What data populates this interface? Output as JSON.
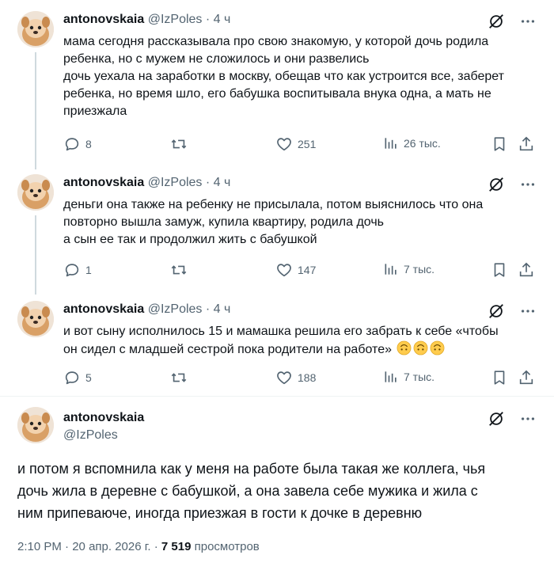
{
  "colors": {
    "text": "#0f1419",
    "muted": "#536471",
    "line": "#cfd9de"
  },
  "replies": [
    {
      "name": "antonovskaia",
      "handle": "@IzPoles",
      "time": "4 ч",
      "lines": [
        "мама сегодня рассказывала про свою знакомую, у которой дочь родила",
        "ребенка, но с мужем не сложилось и они развелись",
        "дочь уехала на заработки в москву, обещав что как устроится все, заберет",
        "ребенка, но время шло, его бабушка воспитывала внука одна, а мать не",
        "приезжала"
      ],
      "replies_count": "8",
      "retweets": "",
      "likes": "251",
      "views": "26 тыс."
    },
    {
      "name": "antonovskaia",
      "handle": "@IzPoles",
      "time": "4 ч",
      "lines": [
        "деньги она также на ребенку не присылала, потом выяснилось что она",
        "повторно вышла замуж, купила квартиру, родила дочь",
        "а сын ее так и продолжил жить с бабушкой"
      ],
      "replies_count": "1",
      "retweets": "",
      "likes": "147",
      "views": "7 тыс."
    },
    {
      "name": "antonovskaia",
      "handle": "@IzPoles",
      "time": "4 ч",
      "lines": [
        "и вот сыну исполнилось 15 и мамашка решила его забрать к себе «чтобы",
        "он сидел с младшей сестрой пока родители на работе»"
      ],
      "emoji": "upside-down-face-icon",
      "replies_count": "5",
      "retweets": "",
      "likes": "188",
      "views": "7 тыс."
    }
  ],
  "main": {
    "name": "antonovskaia",
    "handle": "@IzPoles",
    "lines": [
      "и потом я вспомнила как у меня на работе была такая же коллега, чья",
      "дочь жила в деревне с бабушкой, а она завела себе мужика и жила с",
      "ним припеваюче, иногда приезжая в гости к дочке в деревню"
    ],
    "time": "2:10 PM",
    "date": "20 апр. 2026 г.",
    "views_count": "7 519",
    "views_label": "просмотров"
  },
  "icons": {
    "grok": "grok-icon",
    "more": "more-icon",
    "reply": "reply-icon",
    "retweet": "retweet-icon",
    "like": "like-icon",
    "views": "views-icon",
    "bookmark": "bookmark-icon",
    "share": "share-icon"
  }
}
